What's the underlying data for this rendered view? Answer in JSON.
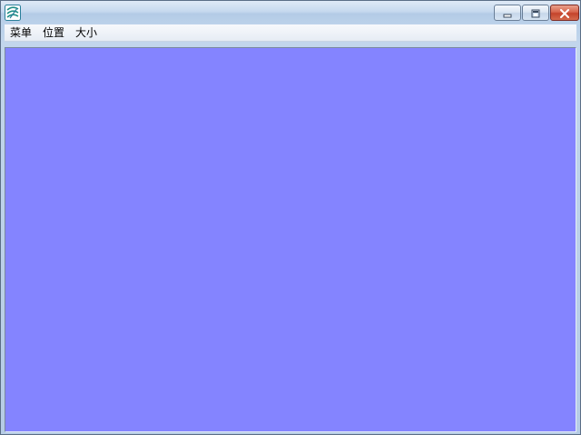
{
  "window": {
    "icon": "app-logo-icon",
    "caption": {
      "minimize_icon": "minimize-icon",
      "maximize_icon": "maximize-icon",
      "close_icon": "close-icon",
      "close_color": "#c9472f"
    }
  },
  "menubar": {
    "items": [
      {
        "label": "菜单"
      },
      {
        "label": "位置"
      },
      {
        "label": "大小"
      }
    ]
  },
  "client": {
    "background_color": "#8484ff"
  }
}
